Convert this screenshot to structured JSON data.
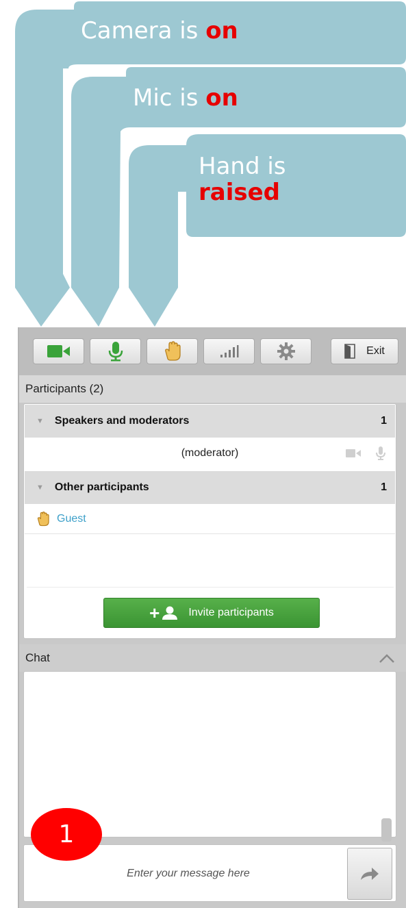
{
  "callouts": {
    "camera": {
      "prefix": "Camera is ",
      "state": "on"
    },
    "mic": {
      "prefix": "Mic is ",
      "state": "on"
    },
    "hand": {
      "prefix": "Hand is",
      "state": "raised"
    },
    "callout_color": "#9dc8d2",
    "highlight_color": "#e60000"
  },
  "toolbar": {
    "buttons": [
      {
        "icon": "video-camera-icon",
        "state": "on",
        "color": "#3aa33a"
      },
      {
        "icon": "microphone-icon",
        "state": "on",
        "color": "#3aa33a"
      },
      {
        "icon": "raised-hand-icon",
        "state": "raised",
        "color": "#f0c05a"
      },
      {
        "icon": "signal-bars-icon"
      },
      {
        "icon": "gear-icon"
      }
    ],
    "exit_label": "Exit"
  },
  "participants": {
    "header": "Participants (2)",
    "groups": [
      {
        "name": "Speakers and moderators",
        "count": "1",
        "members": [
          {
            "name": "(moderator)",
            "icons": [
              "video-camera-icon",
              "microphone-icon"
            ]
          }
        ]
      },
      {
        "name": "Other participants",
        "count": "1",
        "members": [
          {
            "name": "Guest",
            "icon": "raised-hand-icon"
          }
        ]
      }
    ],
    "invite_label": "Invite participants"
  },
  "chat": {
    "header": "Chat",
    "input_placeholder": "Enter your message here",
    "badge": "1"
  }
}
